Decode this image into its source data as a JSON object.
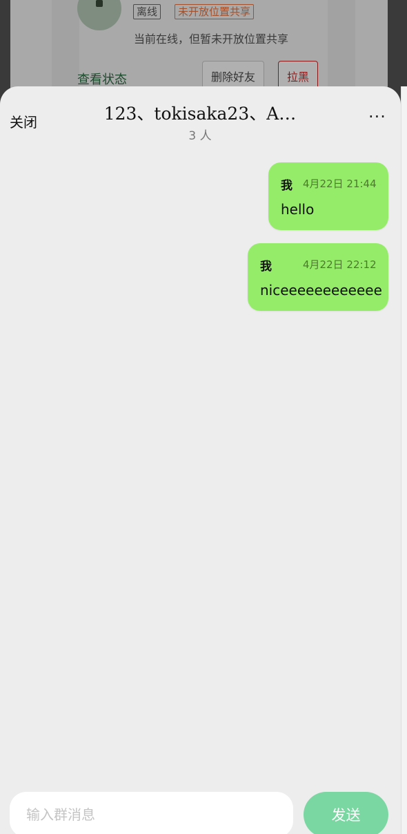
{
  "background": {
    "offline_tag": "离线",
    "location_tag": "未开放位置共享",
    "status_text": "当前在线，但暂未开放位置共享",
    "view_status": "查看状态",
    "delete_friend": "删除好友",
    "block": "拉黑"
  },
  "header": {
    "close_label": "关闭",
    "title": "123、tokisaka23、A…",
    "member_count": "3 人",
    "more_icon": "more-icon"
  },
  "messages": [
    {
      "sender": "我",
      "time": "4月22日 21:44",
      "text": "hello"
    },
    {
      "sender": "我",
      "time": "4月22日 22:12",
      "text": "niceeeeeeeeeeee"
    }
  ],
  "composer": {
    "placeholder": "输入群消息",
    "value": "",
    "send_label": "发送"
  },
  "colors": {
    "bubble": "#95ec69",
    "send_button": "#7ad7a2",
    "sheet_bg": "#ededed"
  }
}
